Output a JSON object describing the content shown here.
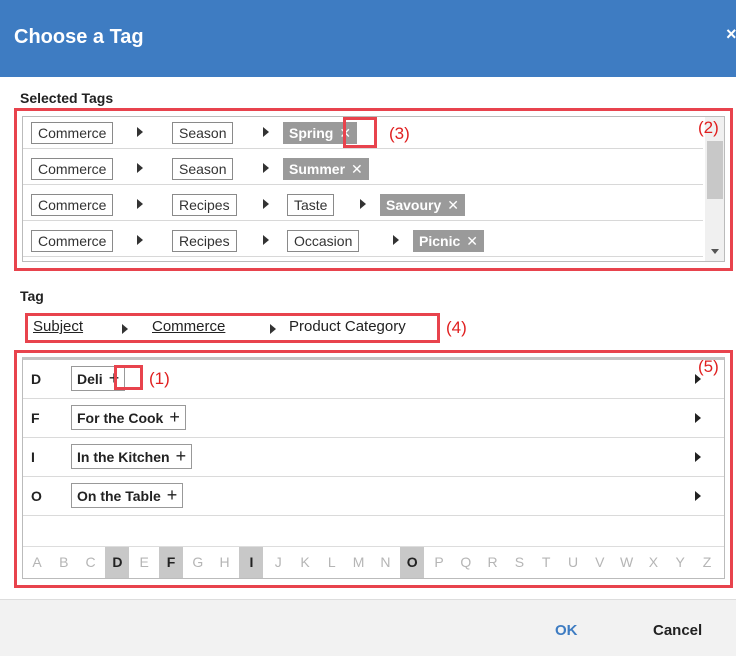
{
  "dialog": {
    "title": "Choose a Tag",
    "close_glyph": "×"
  },
  "selected": {
    "label": "Selected Tags",
    "rows": [
      {
        "path": [
          "Commerce",
          "Season"
        ],
        "leaf": "Spring"
      },
      {
        "path": [
          "Commerce",
          "Season"
        ],
        "leaf": "Summer"
      },
      {
        "path": [
          "Commerce",
          "Recipes",
          "Taste"
        ],
        "leaf": "Savoury"
      },
      {
        "path": [
          "Commerce",
          "Recipes",
          "Occasion"
        ],
        "leaf": "Picnic"
      }
    ],
    "remove_glyph": "✕"
  },
  "tag": {
    "label": "Tag",
    "breadcrumb": [
      "Subject",
      "Commerce",
      "Product Category"
    ],
    "groups": [
      {
        "letter": "D",
        "name": "Deli"
      },
      {
        "letter": "F",
        "name": "For the Cook"
      },
      {
        "letter": "I",
        "name": "In the Kitchen"
      },
      {
        "letter": "O",
        "name": "On the Table"
      }
    ],
    "add_glyph": "+",
    "alphabet": [
      "A",
      "B",
      "C",
      "D",
      "E",
      "F",
      "G",
      "H",
      "I",
      "J",
      "K",
      "L",
      "M",
      "N",
      "O",
      "P",
      "Q",
      "R",
      "S",
      "T",
      "U",
      "V",
      "W",
      "X",
      "Y",
      "Z"
    ],
    "active_letters": [
      "D",
      "F",
      "I",
      "O"
    ]
  },
  "annotations": [
    "(1)",
    "(2)",
    "(3)",
    "(4)",
    "(5)"
  ],
  "footer": {
    "ok_label": "OK",
    "cancel_label": "Cancel"
  },
  "colors": {
    "title_bar": "#3e7cc2",
    "annotation": "#e8434d",
    "leaf_tag": "#9a9a9a",
    "ok": "#3e7cc2"
  }
}
